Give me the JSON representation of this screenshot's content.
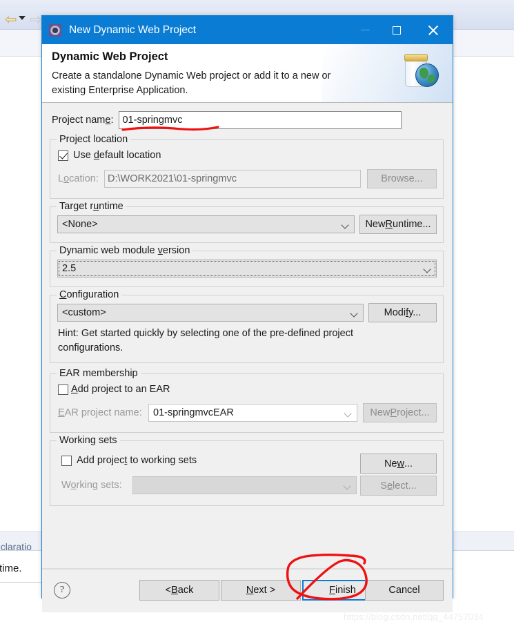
{
  "background": {
    "text_lines": [
      "eclaratio",
      "time."
    ],
    "toolbar_icons": [
      "back-arrow-icon",
      "dropdown-caret-icon",
      "forward-arrow-icon"
    ]
  },
  "watermark": "https://blog.csdn.net/qq_44757034",
  "dialog": {
    "title": "New Dynamic Web Project",
    "title_icon": "eclipse-gear-icon",
    "window_controls": {
      "minimize": "minimize-icon",
      "maximize": "maximize-icon",
      "close": "close-icon"
    },
    "header": {
      "title": "Dynamic Web Project",
      "description_line1": "Create a standalone Dynamic Web project or add it to a new or",
      "description_line2": "existing Enterprise Application.",
      "icon": "web-project-jar-globe-icon"
    },
    "project_name": {
      "label": "Project name:",
      "value": "01-springmvc"
    },
    "project_location": {
      "group_title": "Project location",
      "use_default_label": "Use default location",
      "use_default_checked": true,
      "location_label": "Location:",
      "location_value": "D:\\WORK2021\\01-springmvc",
      "browse_label": "Browse..."
    },
    "target_runtime": {
      "group_title": "Target runtime",
      "value": "<None>",
      "new_runtime_label": "New Runtime..."
    },
    "dynamic_web_module_version": {
      "group_title": "Dynamic web module version",
      "value": "2.5"
    },
    "configuration": {
      "group_title": "Configuration",
      "value": "<custom>",
      "modify_label": "Modify...",
      "hint_line1": "Hint: Get started quickly by selecting one of the pre-defined project",
      "hint_line2": "configurations."
    },
    "ear_membership": {
      "group_title": "EAR membership",
      "add_project_label": "Add project to an EAR",
      "add_project_checked": false,
      "ear_project_name_label": "EAR project name:",
      "ear_project_name_value": "01-springmvcEAR",
      "new_project_label": "New Project..."
    },
    "working_sets": {
      "group_title": "Working sets",
      "add_to_working_sets_label": "Add project to working sets",
      "add_to_working_sets_checked": false,
      "working_sets_label": "Working sets:",
      "working_sets_value": "",
      "new_label": "New...",
      "select_label": "Select..."
    },
    "footer": {
      "help_icon": "help-question-icon",
      "back_label": "< Back",
      "next_label": "Next >",
      "finish_label": "Finish",
      "cancel_label": "Cancel",
      "default_button": "Finish"
    }
  },
  "colors": {
    "titlebar": "#0b7cd4",
    "dialog_bg": "#f0f0f0",
    "annotation_red": "#ee1111",
    "default_button_border": "#0b7cd4"
  },
  "annotations": [
    {
      "name": "underline-project-name",
      "shape": "red-underline"
    },
    {
      "name": "circle-finish-button",
      "shape": "red-ellipse"
    }
  ]
}
